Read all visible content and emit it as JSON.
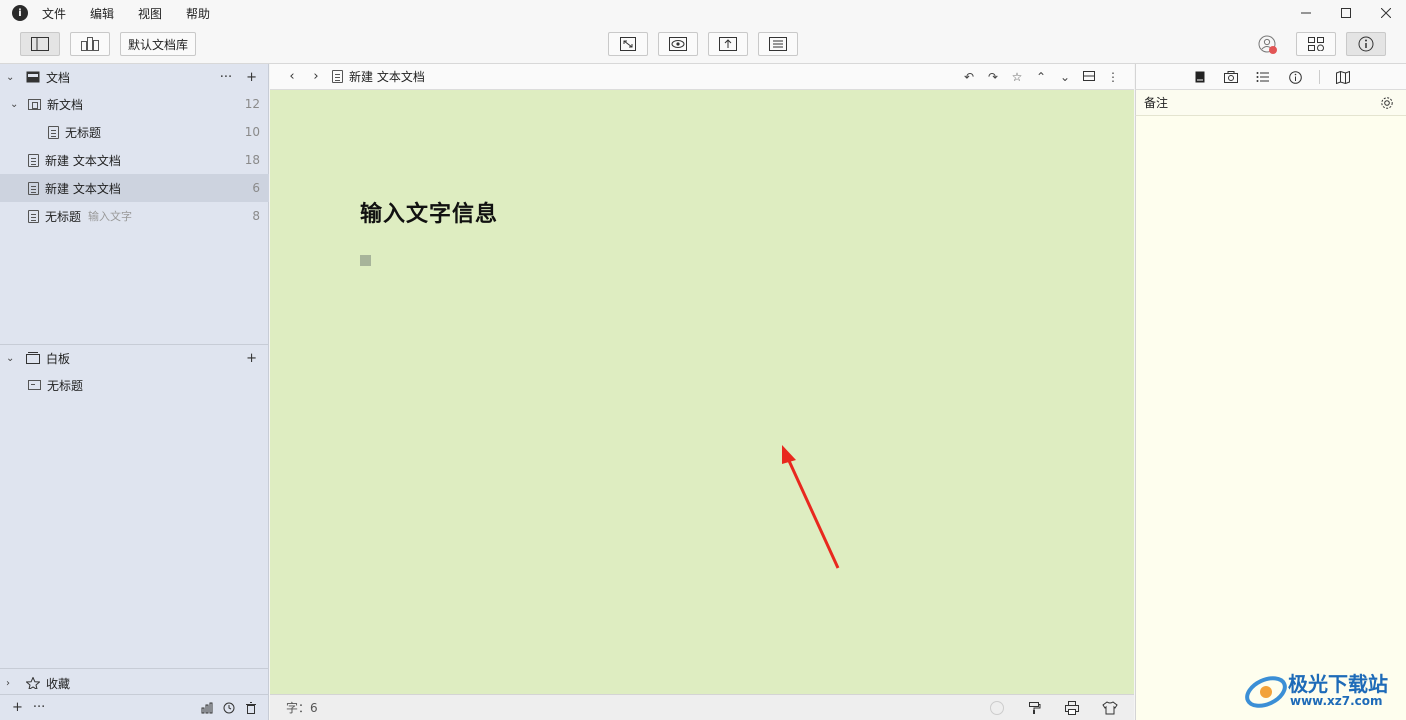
{
  "menubar": {
    "items": [
      "文件",
      "编辑",
      "视图",
      "帮助"
    ]
  },
  "toolbar": {
    "library_label": "默认文档库"
  },
  "sidebar": {
    "documents_section": {
      "title": "文档",
      "more_label": "···",
      "add_label": "+"
    },
    "items": [
      {
        "label": "新文档",
        "count": "12",
        "icon": "folder-doc-icon"
      },
      {
        "label": "无标题",
        "count": "10",
        "icon": "doc-icon"
      },
      {
        "label": "新建 文本文档",
        "count": "18",
        "icon": "doc-icon"
      },
      {
        "label": "新建 文本文档",
        "count": "6",
        "icon": "doc-icon",
        "selected": true
      },
      {
        "label": "无标题",
        "sub": "输入文字",
        "count": "8",
        "icon": "doc-icon"
      }
    ],
    "boards_section": {
      "title": "白板",
      "add_label": "+",
      "items": [
        {
          "label": "无标题",
          "icon": "board-icon"
        }
      ]
    },
    "favorites_section": {
      "title": "收藏"
    },
    "footer": {
      "add_label": "+",
      "more_label": "···"
    }
  },
  "editor": {
    "breadcrumb_title": "新建 文本文档",
    "heading": "输入文字信息",
    "background_color": "#deedc1",
    "word_count_label": "字：6"
  },
  "inspector": {
    "notes_label": "备注",
    "background_color": "#fefeee"
  },
  "annotation": {
    "arrow_color": "#e8281e"
  },
  "watermark": {
    "title": "极光下载站",
    "url": "www.xz7.com"
  }
}
